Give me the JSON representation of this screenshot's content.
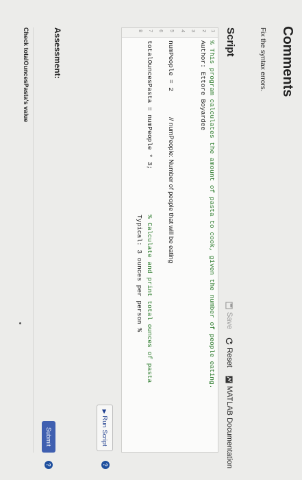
{
  "page": {
    "title": "Comments",
    "subtitle": "Fix the syntax errors."
  },
  "script": {
    "heading": "Script",
    "toolbar": {
      "save": "Save",
      "reset": "Reset",
      "docs": "MATLAB Documentation"
    },
    "line_numbers": [
      "1",
      "2",
      "3",
      "4",
      "5",
      "6",
      "7",
      "8"
    ],
    "lines": {
      "l1": "% This program calculates the amount of pasta to cook, given the number of people eating.",
      "l2": "Author: Ettore Boyardee",
      "l5a": "numPeople = 2",
      "l5b": "// numPeople: Number of people that will be eating",
      "l7a": "totalOuncesPasta = numPeople * 3;",
      "l7b": "% Calculate and print total ounces of pasta",
      "l8": "Typical: 3 ounces per person %"
    },
    "run_label": "Run Script"
  },
  "assessment": {
    "heading": "Assessment:",
    "submit_label": "Submit",
    "check_label": "Check totalOuncesPasta's value"
  },
  "colors": {
    "accent": "#1e4f9e",
    "submit": "#3f5fb0",
    "comment": "#2a7a2a"
  }
}
